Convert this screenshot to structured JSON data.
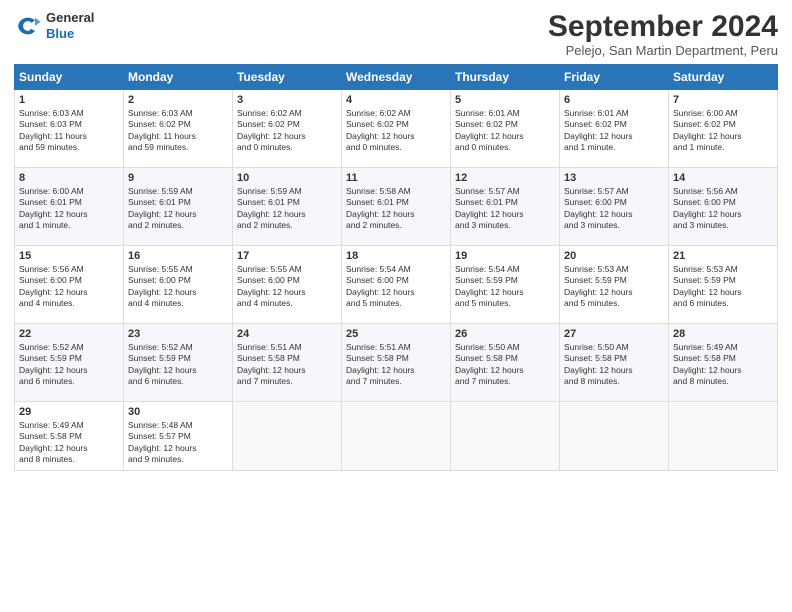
{
  "header": {
    "logo_line1": "General",
    "logo_line2": "Blue",
    "month": "September 2024",
    "location": "Pelejo, San Martin Department, Peru"
  },
  "days_of_week": [
    "Sunday",
    "Monday",
    "Tuesday",
    "Wednesday",
    "Thursday",
    "Friday",
    "Saturday"
  ],
  "weeks": [
    [
      {
        "day": "1",
        "info": "Sunrise: 6:03 AM\nSunset: 6:03 PM\nDaylight: 11 hours\nand 59 minutes."
      },
      {
        "day": "2",
        "info": "Sunrise: 6:03 AM\nSunset: 6:02 PM\nDaylight: 11 hours\nand 59 minutes."
      },
      {
        "day": "3",
        "info": "Sunrise: 6:02 AM\nSunset: 6:02 PM\nDaylight: 12 hours\nand 0 minutes."
      },
      {
        "day": "4",
        "info": "Sunrise: 6:02 AM\nSunset: 6:02 PM\nDaylight: 12 hours\nand 0 minutes."
      },
      {
        "day": "5",
        "info": "Sunrise: 6:01 AM\nSunset: 6:02 PM\nDaylight: 12 hours\nand 0 minutes."
      },
      {
        "day": "6",
        "info": "Sunrise: 6:01 AM\nSunset: 6:02 PM\nDaylight: 12 hours\nand 1 minute."
      },
      {
        "day": "7",
        "info": "Sunrise: 6:00 AM\nSunset: 6:02 PM\nDaylight: 12 hours\nand 1 minute."
      }
    ],
    [
      {
        "day": "8",
        "info": "Sunrise: 6:00 AM\nSunset: 6:01 PM\nDaylight: 12 hours\nand 1 minute."
      },
      {
        "day": "9",
        "info": "Sunrise: 5:59 AM\nSunset: 6:01 PM\nDaylight: 12 hours\nand 2 minutes."
      },
      {
        "day": "10",
        "info": "Sunrise: 5:59 AM\nSunset: 6:01 PM\nDaylight: 12 hours\nand 2 minutes."
      },
      {
        "day": "11",
        "info": "Sunrise: 5:58 AM\nSunset: 6:01 PM\nDaylight: 12 hours\nand 2 minutes."
      },
      {
        "day": "12",
        "info": "Sunrise: 5:57 AM\nSunset: 6:01 PM\nDaylight: 12 hours\nand 3 minutes."
      },
      {
        "day": "13",
        "info": "Sunrise: 5:57 AM\nSunset: 6:00 PM\nDaylight: 12 hours\nand 3 minutes."
      },
      {
        "day": "14",
        "info": "Sunrise: 5:56 AM\nSunset: 6:00 PM\nDaylight: 12 hours\nand 3 minutes."
      }
    ],
    [
      {
        "day": "15",
        "info": "Sunrise: 5:56 AM\nSunset: 6:00 PM\nDaylight: 12 hours\nand 4 minutes."
      },
      {
        "day": "16",
        "info": "Sunrise: 5:55 AM\nSunset: 6:00 PM\nDaylight: 12 hours\nand 4 minutes."
      },
      {
        "day": "17",
        "info": "Sunrise: 5:55 AM\nSunset: 6:00 PM\nDaylight: 12 hours\nand 4 minutes."
      },
      {
        "day": "18",
        "info": "Sunrise: 5:54 AM\nSunset: 6:00 PM\nDaylight: 12 hours\nand 5 minutes."
      },
      {
        "day": "19",
        "info": "Sunrise: 5:54 AM\nSunset: 5:59 PM\nDaylight: 12 hours\nand 5 minutes."
      },
      {
        "day": "20",
        "info": "Sunrise: 5:53 AM\nSunset: 5:59 PM\nDaylight: 12 hours\nand 5 minutes."
      },
      {
        "day": "21",
        "info": "Sunrise: 5:53 AM\nSunset: 5:59 PM\nDaylight: 12 hours\nand 6 minutes."
      }
    ],
    [
      {
        "day": "22",
        "info": "Sunrise: 5:52 AM\nSunset: 5:59 PM\nDaylight: 12 hours\nand 6 minutes."
      },
      {
        "day": "23",
        "info": "Sunrise: 5:52 AM\nSunset: 5:59 PM\nDaylight: 12 hours\nand 6 minutes."
      },
      {
        "day": "24",
        "info": "Sunrise: 5:51 AM\nSunset: 5:58 PM\nDaylight: 12 hours\nand 7 minutes."
      },
      {
        "day": "25",
        "info": "Sunrise: 5:51 AM\nSunset: 5:58 PM\nDaylight: 12 hours\nand 7 minutes."
      },
      {
        "day": "26",
        "info": "Sunrise: 5:50 AM\nSunset: 5:58 PM\nDaylight: 12 hours\nand 7 minutes."
      },
      {
        "day": "27",
        "info": "Sunrise: 5:50 AM\nSunset: 5:58 PM\nDaylight: 12 hours\nand 8 minutes."
      },
      {
        "day": "28",
        "info": "Sunrise: 5:49 AM\nSunset: 5:58 PM\nDaylight: 12 hours\nand 8 minutes."
      }
    ],
    [
      {
        "day": "29",
        "info": "Sunrise: 5:49 AM\nSunset: 5:58 PM\nDaylight: 12 hours\nand 8 minutes."
      },
      {
        "day": "30",
        "info": "Sunrise: 5:48 AM\nSunset: 5:57 PM\nDaylight: 12 hours\nand 9 minutes."
      },
      {
        "day": "",
        "info": ""
      },
      {
        "day": "",
        "info": ""
      },
      {
        "day": "",
        "info": ""
      },
      {
        "day": "",
        "info": ""
      },
      {
        "day": "",
        "info": ""
      }
    ]
  ]
}
